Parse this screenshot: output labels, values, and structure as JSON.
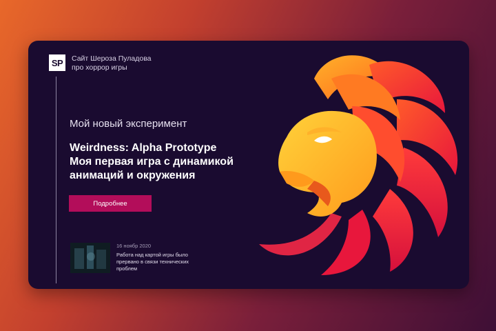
{
  "brand": {
    "logo": "SP",
    "line1": "Сайт Шероза Пуладова",
    "line2": "про хоррор игры"
  },
  "hero": {
    "subtitle": "Мой новый эксперимент",
    "title_line1": "Weirdness: Alpha Prototype",
    "title_line2": "Моя первая игра с динамикой",
    "title_line3": "анимаций и окружения",
    "button_label": "Подробнее"
  },
  "news": {
    "date": "16 ноябр 2020",
    "text": "Работа над картой игры было прервано в связи технических проблем"
  },
  "colors": {
    "card_bg": "#1a0b30",
    "button_bg": "#b30d5a",
    "accent_orange": "#ff8a1e",
    "accent_red": "#e8173c"
  },
  "icons": [
    "lion-illustration"
  ]
}
